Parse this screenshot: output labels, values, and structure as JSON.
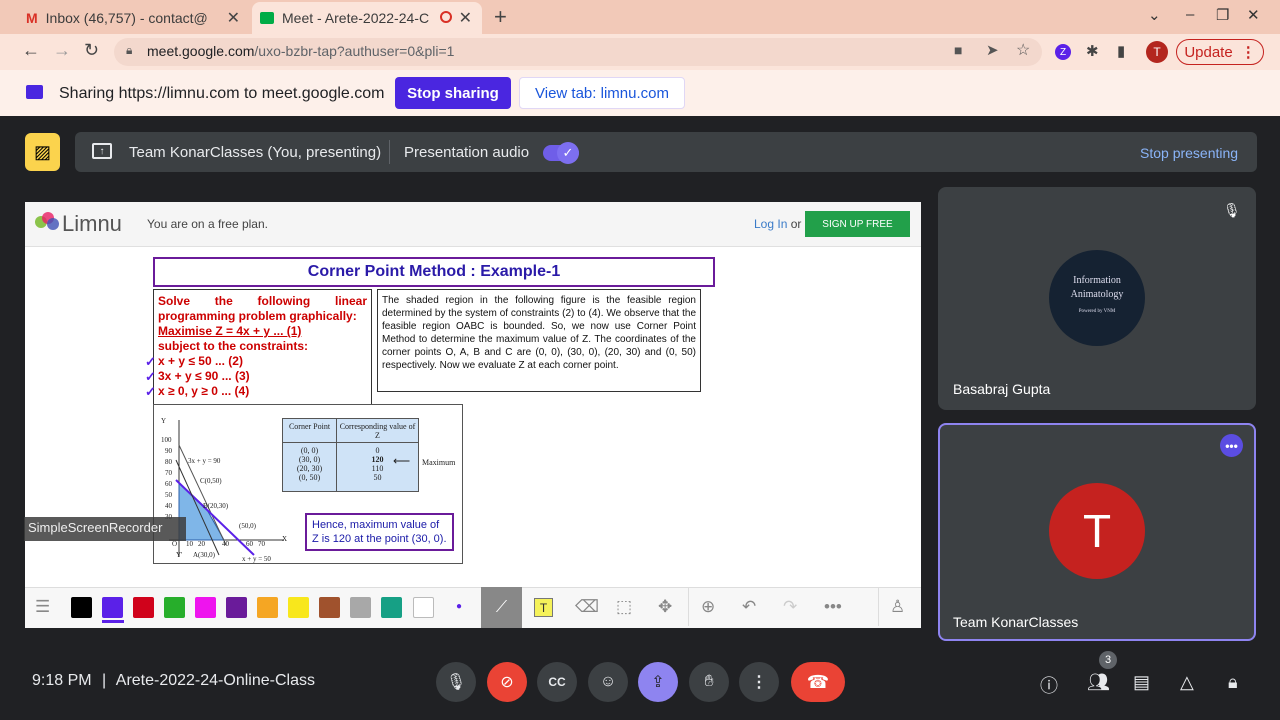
{
  "browser": {
    "tabs": [
      {
        "label": "Inbox (46,757) - contact@",
        "icon": "gmail-icon"
      },
      {
        "label": "Meet - Arete-2022-24-C",
        "icon": "meet-icon"
      }
    ],
    "url_host": "meet.google.com",
    "url_path": "/uxo-bzbr-tap?authuser=0&pli=1",
    "update_label": "Update",
    "avatar_letter": "T"
  },
  "sharing": {
    "text": "Sharing https://limnu.com to meet.google.com",
    "stop_label": "Stop sharing",
    "view_tab_label": "View tab: limnu.com"
  },
  "presenting": {
    "who": "Team KonarClasses (You, presenting)",
    "audio_label": "Presentation audio",
    "stop_label": "Stop presenting"
  },
  "limnu": {
    "logo": "Limnu",
    "plan_text": "You are on a free plan.",
    "login": "Log In",
    "or": "or",
    "signup": "SIGN UP FREE"
  },
  "slide": {
    "title": "Corner Point Method : Example-1",
    "left_lines": [
      "Solve the following linear",
      "programming problem graphically:",
      "Maximise Z = 4x + y ... (1)",
      "subject to the constraints:",
      "x + y ≤ 50 ... (2)",
      "3x + y ≤ 90 ... (3)",
      "x ≥ 0, y ≥ 0 ... (4)"
    ],
    "right_text": "The shaded region in the following figure is the feasible region determined by the system of constraints (2) to (4). We observe that the feasible region OABC is bounded. So, we now use Corner Point Method to determine the maximum value of Z. The coordinates of the corner points O, A, B and C are (0, 0), (30, 0), (20, 30) and (0, 50) respectively. Now we evaluate Z at each corner point.",
    "table_headers": [
      "Corner Point",
      "Corresponding value of Z"
    ],
    "table_points": [
      "(0, 0)",
      "(30, 0)",
      "(20, 30)",
      "(0, 50)"
    ],
    "table_values": [
      "0",
      "120",
      "110",
      "50"
    ],
    "maximum_label": "Maximum",
    "hence": "Hence, maximum value of Z is 120 at the point (30, 0).",
    "graph_labels": {
      "y": "Y",
      "x": "X",
      "yprime": "Y'",
      "o": "O",
      "l1": "3x + y = 90",
      "l2": "x + y = 50",
      "c": "C(0,50)",
      "b": "B(20,30)",
      "a": "A(30,0)",
      "p": "(50,0)",
      "y100": "100",
      "y90": "90",
      "y80": "80",
      "y70": "70",
      "y60": "60",
      "y50": "50",
      "y40": "40",
      "y30": "30",
      "x10": "10",
      "x20": "20",
      "x40": "40",
      "x60": "60",
      "x70": "70"
    }
  },
  "recorder_label": "SimpleScreenRecorder",
  "toolbar_colors": [
    "#000000",
    "#5b21e8",
    "#d0021b",
    "#27ae2b",
    "#ee14ee",
    "#6a1b9a",
    "#f5a623",
    "#f8e71c",
    "#a0522d",
    "#a8a8a8",
    "#16a085",
    "#ffffff"
  ],
  "participants": [
    {
      "name": "Basabraj Gupta",
      "avatar_text": "Information Animatology",
      "avatar_sub": "Powered by VNM"
    },
    {
      "name": "Team KonarClasses",
      "initial": "T"
    }
  ],
  "meeting": {
    "time": "9:18 PM",
    "separator": "|",
    "name": "Arete-2022-24-Online-Class",
    "participant_count": "3"
  }
}
